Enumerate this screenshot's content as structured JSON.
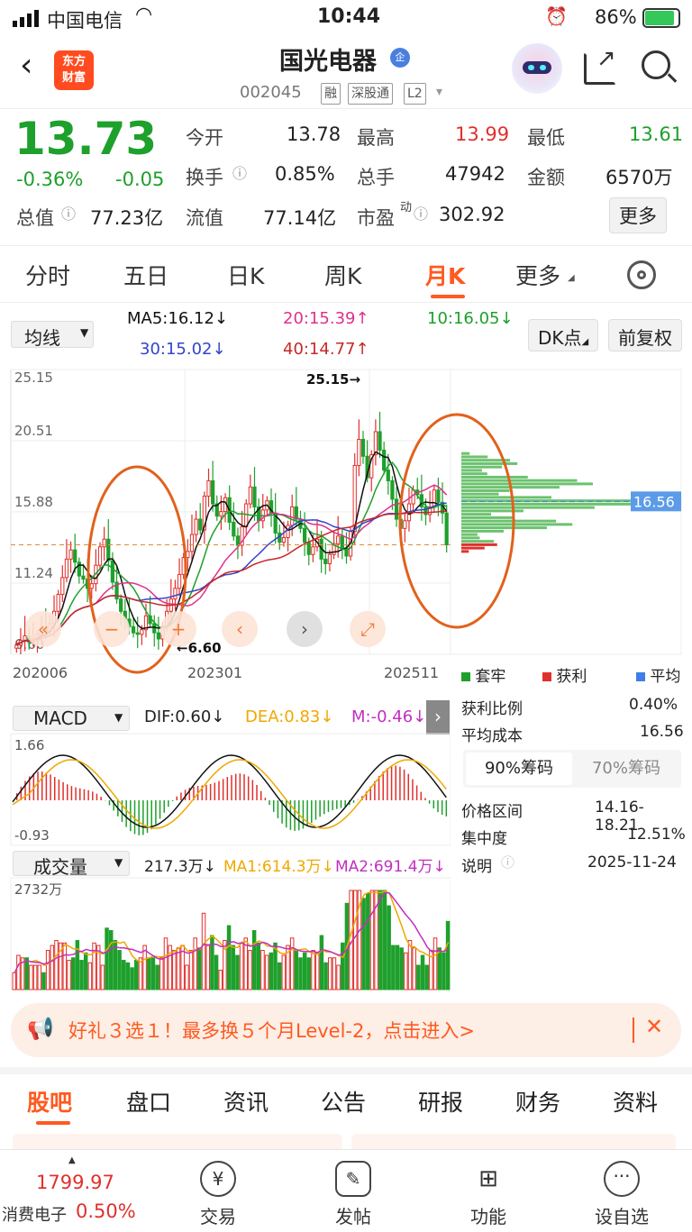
{
  "status_bar": {
    "carrier": "中国电信",
    "time": "10:44",
    "battery": "86%"
  },
  "header": {
    "back_icon": "chevron-left-icon",
    "logo_text": "东方\n财富",
    "stock_name": "国光电器",
    "stock_code": "002045",
    "badges": [
      "融",
      "深股通",
      "L2"
    ],
    "share_icon": "share-icon",
    "search_icon": "search-icon"
  },
  "quote": {
    "price": "13.73",
    "change_pct": "-0.36%",
    "change": "-0.05",
    "fields": [
      {
        "label": "今开",
        "value": "13.78"
      },
      {
        "label": "最高",
        "value": "13.99"
      },
      {
        "label": "最低",
        "value": "13.61"
      },
      {
        "label": "换手",
        "value": "0.85%"
      },
      {
        "label": "总手",
        "value": "47942"
      },
      {
        "label": "金额",
        "value": "6570万"
      },
      {
        "label": "总值",
        "value": "77.23亿"
      },
      {
        "label": "流值",
        "value": "77.14亿"
      },
      {
        "label": "市盈",
        "value": "302.92"
      }
    ],
    "more_label": "更多",
    "pe_superscript": "动"
  },
  "tabs": [
    "分时",
    "五日",
    "日K",
    "周K",
    "月K",
    "更多"
  ],
  "active_tab": "月K",
  "ma": {
    "selector": "均线",
    "ma5": "MA5:16.12↓",
    "ma20": "20:15.39↑",
    "ma10": "10:16.05↓",
    "ma30": "30:15.02↓",
    "ma40": "40:14.77↑",
    "dk": "DK点",
    "adjust": "前复权"
  },
  "chart_data": [
    {
      "type": "candlestick",
      "title": "",
      "y_ticks": [
        "25.15",
        "20.51",
        "15.88",
        "11.24",
        "6.60"
      ],
      "x_ticks": [
        "202006",
        "202301",
        "202511"
      ],
      "max_label": "25.15",
      "min_label": "6.60",
      "current_marker": "16.56",
      "close_series": [
        7.2,
        7.5,
        7.8,
        7.4,
        7.6,
        7.9,
        8.3,
        8.1,
        8.6,
        9.4,
        10.5,
        11.6,
        12.8,
        13.4,
        12.6,
        11.7,
        11.5,
        10.9,
        11.2,
        12.4,
        13.6,
        14.1,
        12.7,
        11.3,
        10.2,
        9.4,
        8.9,
        8.4,
        8.0,
        7.9,
        8.2,
        9.1,
        8.6,
        8.0,
        7.6,
        8.4,
        9.4,
        10.2,
        10.9,
        11.8,
        12.9,
        13.3,
        14.4,
        15.4,
        14.7,
        16.9,
        17.9,
        16.4,
        15.6,
        15.9,
        16.8,
        15.2,
        14.3,
        13.7,
        14.9,
        16.4,
        17.5,
        16.2,
        15.3,
        16.0,
        16.6,
        15.8,
        14.5,
        13.9,
        14.2,
        15.0,
        16.2,
        15.4,
        14.8,
        13.9,
        13.1,
        13.6,
        14.1,
        12.8,
        12.5,
        13.1,
        13.8,
        14.3,
        13.5,
        13.0,
        14.6,
        18.9,
        20.6,
        19.5,
        18.1,
        19.6,
        21.1,
        19.9,
        18.6,
        17.9,
        16.7,
        15.4,
        14.8,
        15.3,
        16.4,
        17.3,
        17.0,
        16.2,
        15.7,
        16.2,
        17.3,
        16.5,
        15.8,
        13.73
      ]
    },
    {
      "type": "bar",
      "title": "MACD",
      "y_ticks": [
        "1.66",
        "-0.93"
      ]
    },
    {
      "type": "bar",
      "title": "成交量",
      "y_ticks": [
        "2732万"
      ]
    }
  ],
  "chips": {
    "legend": [
      "套牢",
      "获利",
      "平均"
    ],
    "rows": [
      {
        "label": "获利比例",
        "value": "0.40%"
      },
      {
        "label": "平均成本",
        "value": "16.56"
      }
    ],
    "tab_90": "90%筹码",
    "tab_70": "70%筹码",
    "rows2": [
      {
        "label": "价格区间",
        "value": "14.16-18.21"
      },
      {
        "label": "集中度",
        "value": "12.51%"
      },
      {
        "label": "说明",
        "value": "2025-11-24"
      }
    ]
  },
  "macd": {
    "selector": "MACD",
    "dif": "DIF:0.60↓",
    "dea": "DEA:0.83↓",
    "m": "M:-0.46↓"
  },
  "volume": {
    "selector": "成交量",
    "vol": "217.3万↓",
    "ma1": "MA1:614.3万↓",
    "ma2": "MA2:691.4万↓"
  },
  "banner": {
    "text": "好礼３选１！最多换５个月Level-2，点击进入>",
    "close": "✕"
  },
  "bottom_tabs": [
    "股吧",
    "盘口",
    "资讯",
    "公告",
    "研报",
    "财务",
    "资料"
  ],
  "index": {
    "value": "1799.97",
    "name": "消费电子",
    "pct": "0.50%"
  },
  "nav": [
    "交易",
    "发帖",
    "功能",
    "设自选"
  ],
  "colors": {
    "up": "#e0302c",
    "down": "#1ea02c",
    "accent": "#ff5a1f",
    "ma5": "#111111",
    "ma10": "#1ea02c",
    "ma20": "#e0308c",
    "ma30": "#3344cc",
    "ma40": "#c62828"
  }
}
